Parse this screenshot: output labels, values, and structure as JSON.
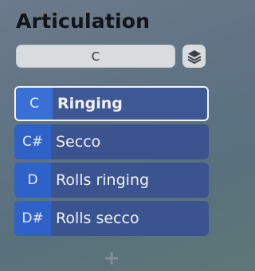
{
  "panel": {
    "title": "Articulation"
  },
  "key_field": {
    "value": "C"
  },
  "icons": {
    "layers": "layers-icon",
    "add": "plus-icon"
  },
  "colors": {
    "row_background": "#3b5490",
    "key_background": "#2f62c8",
    "selected_border": "#f4f6f8"
  },
  "articulations": [
    {
      "key": "C",
      "name": "Ringing",
      "selected": true
    },
    {
      "key": "C#",
      "name": "Secco",
      "selected": false
    },
    {
      "key": "D",
      "name": "Rolls ringing",
      "selected": false
    },
    {
      "key": "D#",
      "name": "Rolls secco",
      "selected": false
    }
  ]
}
